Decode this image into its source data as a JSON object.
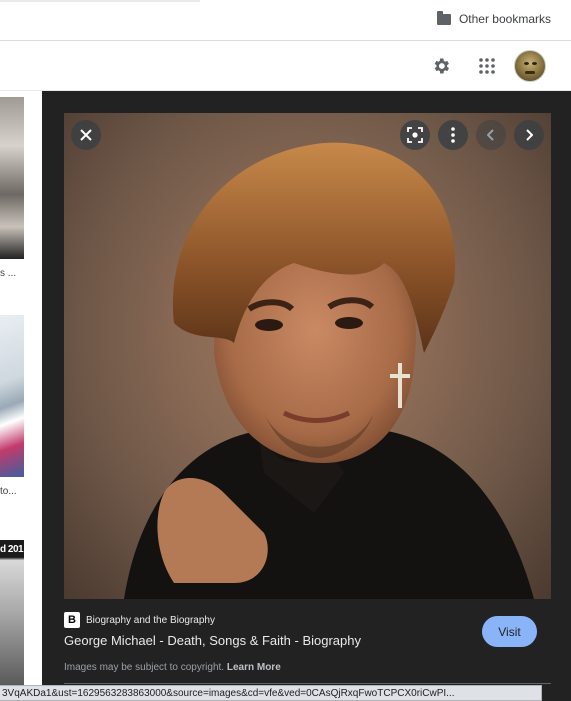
{
  "bookmarks": {
    "other_label": "Other bookmarks"
  },
  "header": {
    "icons": [
      "gear-icon",
      "apps-grid-icon"
    ],
    "avatar": "user-avatar"
  },
  "left_results": [
    {
      "caption": "s ..."
    },
    {
      "caption": "to..."
    },
    {
      "overlay": "d 201"
    }
  ],
  "viewer": {
    "source": {
      "badge": "B",
      "name": "Biography and the Biography"
    },
    "title": "George Michael - Death, Songs & Faith - Biography",
    "visit_label": "Visit",
    "copyright_text": "Images may be subject to copyright.",
    "learn_more": "Learn More",
    "controls": [
      "close-icon",
      "lens-icon",
      "more-vert-icon",
      "chevron-left-icon",
      "chevron-right-icon"
    ]
  },
  "status_bar": {
    "url": "3VqAKDa1&ust=1629563283863000&source=images&cd=vfe&ved=0CAsQjRxqFwoTCPCX0riCwPI..."
  },
  "colors": {
    "panel_bg": "#222222",
    "visit_bg": "#8ab4f8",
    "text_light": "#e8eaed",
    "muted": "#9aa0a6"
  }
}
